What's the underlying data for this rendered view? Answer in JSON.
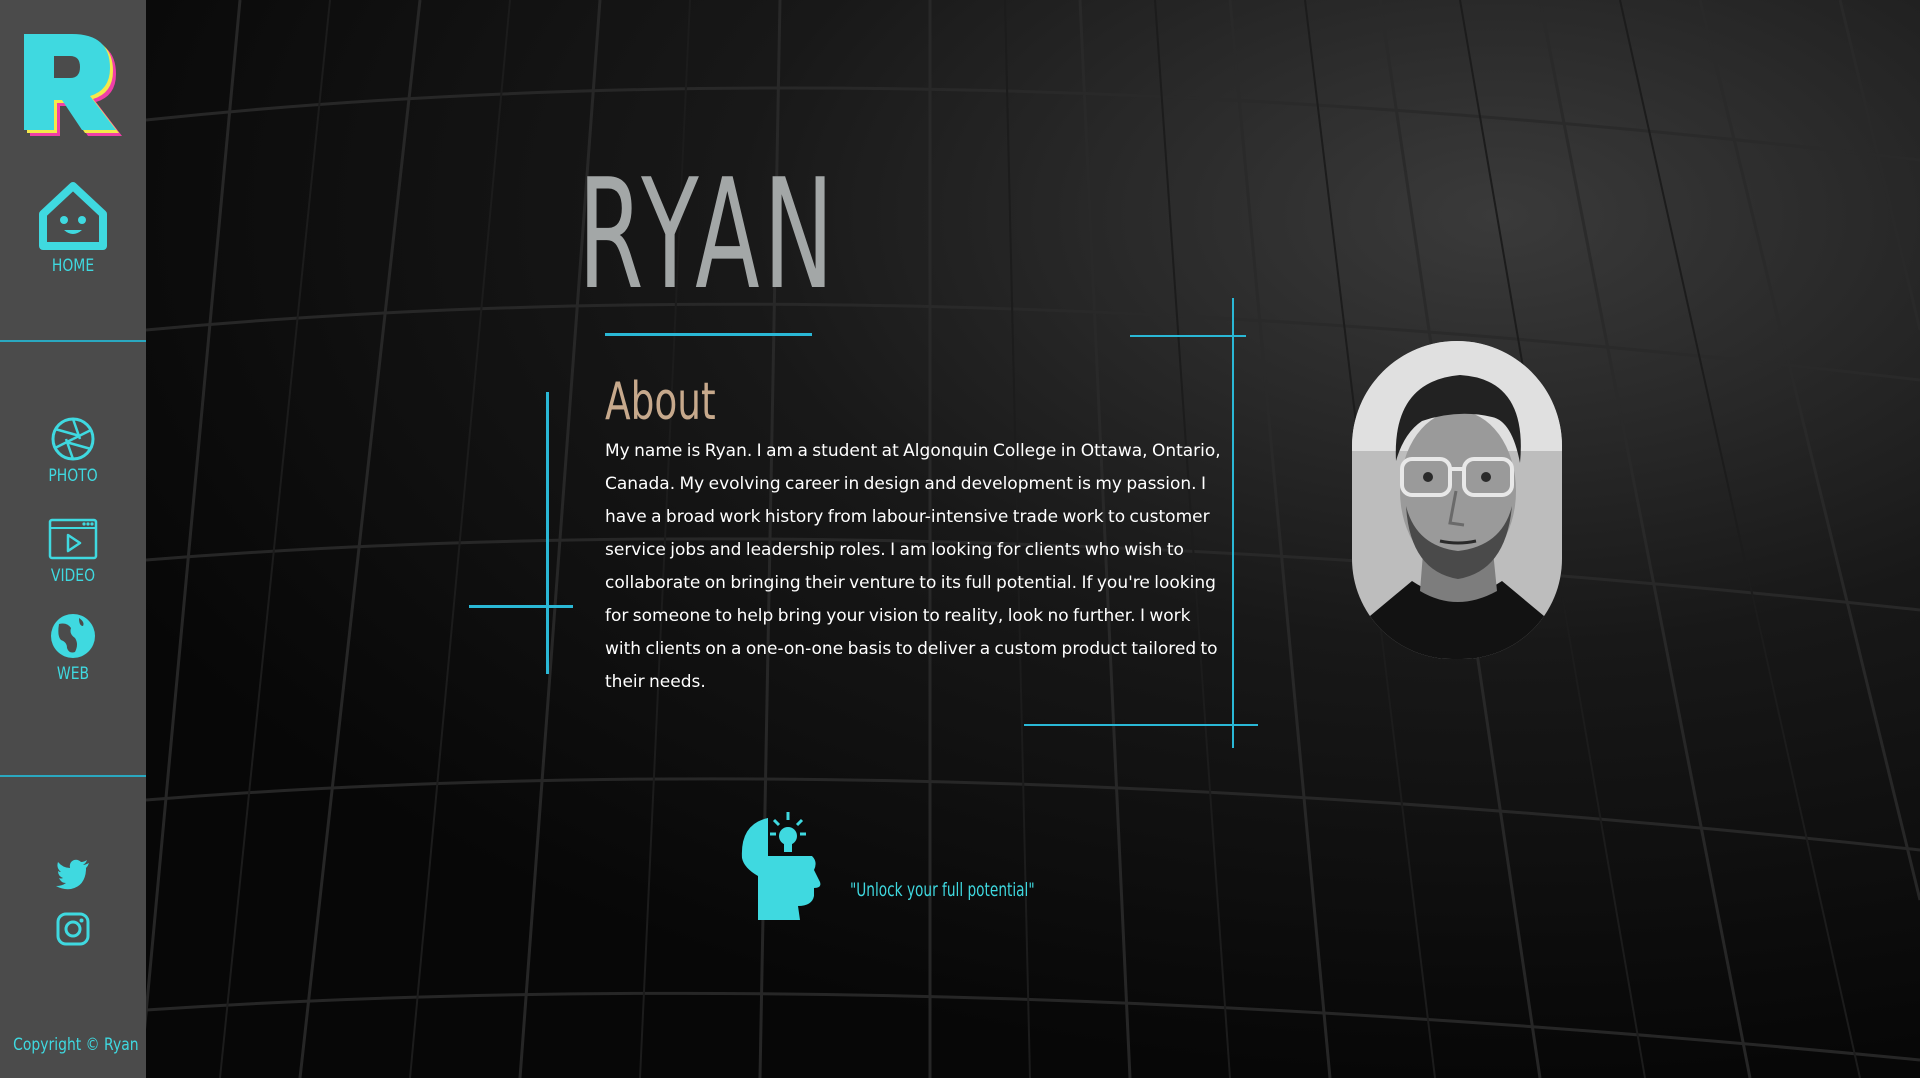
{
  "brand": {
    "logo_letter": "R"
  },
  "sidebar": {
    "nav": [
      {
        "label": "HOME",
        "icon": "home-icon"
      },
      {
        "label": "PHOTO",
        "icon": "camera-aperture-icon"
      },
      {
        "label": "VIDEO",
        "icon": "video-player-icon"
      },
      {
        "label": "WEB",
        "icon": "globe-icon"
      }
    ],
    "social": [
      {
        "icon": "twitter-icon"
      },
      {
        "icon": "instagram-icon"
      }
    ],
    "copyright": "Copyright © Ryan"
  },
  "main": {
    "name": "RYAN",
    "about_heading": "About",
    "about_text": "My name is Ryan. I am a student at Algonquin College in Ottawa, Ontario, Canada. My evolving career in design and development is my passion. I have a broad work history from labour-intensive trade work to customer service jobs and leadership roles. I am looking for clients who wish to collaborate on bringing their venture to its full potential. If you're looking for someone to help bring your vision to reality, look no further. I work with clients on a one-on-one basis to deliver a custom product tailored to their needs.",
    "quote": "\"Unlock your full potential\"",
    "quote_icon": "head-lightbulb-icon"
  },
  "colors": {
    "accent": "#3fd9e0",
    "line": "#2ab8d6",
    "sidebar_bg": "#4b4b4b",
    "title": "#a3a7a7",
    "heading": "#c7a98c",
    "logo_pink": "#f03fa8",
    "logo_yellow": "#f5e94a"
  }
}
